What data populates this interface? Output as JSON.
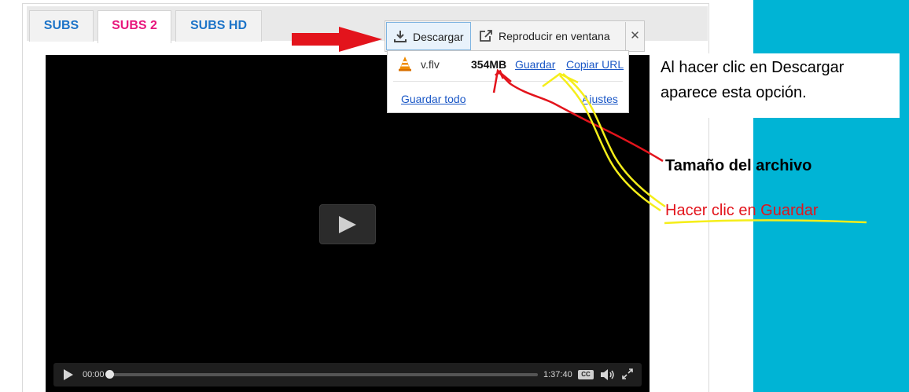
{
  "tabs": [
    {
      "label": "SUBS",
      "color": "#1d74c8"
    },
    {
      "label": "SUBS 2",
      "color": "#e8177d",
      "active": true
    },
    {
      "label": "SUBS HD",
      "color": "#1d74c8"
    }
  ],
  "download_bar": {
    "download_label": "Descargar",
    "popout_label": "Reproducir en ventana",
    "close_label": "✕"
  },
  "download_panel": {
    "file_name": "v.flv",
    "file_size": "354MB",
    "save_label": "Guardar",
    "copy_url_label": "Copiar URL",
    "save_all_label": "Guardar todo",
    "settings_label": "Ajustes"
  },
  "player": {
    "current_time": "00:00",
    "duration": "1:37:40",
    "cc_label": "CC",
    "progress": 0
  },
  "annotations": {
    "note_line1": "Al hacer clic en Descargar",
    "note_line2": "aparece esta opción.",
    "file_size_note": "Tamaño del archivo",
    "save_note": "Hacer clic en Guardar"
  },
  "colors": {
    "accent_blue": "#1d74c8",
    "accent_pink": "#e8177d",
    "side_panel": "#00b4d5",
    "arrow_red": "#e3141c",
    "arrow_yellow": "#f5ee1a",
    "link_blue": "#1a57c6"
  }
}
